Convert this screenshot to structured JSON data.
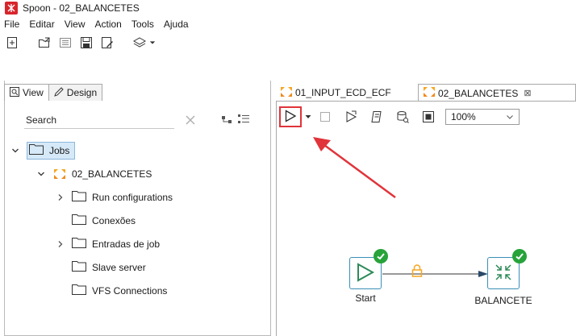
{
  "window": {
    "title": "Spoon - 02_BALANCETES",
    "app_icon": "spoon-app-icon"
  },
  "menu": [
    "File",
    "Editar",
    "View",
    "Action",
    "Tools",
    "Ajuda"
  ],
  "main_toolbar": {
    "icons": [
      "new-file-icon",
      "open-file-icon",
      "explore-repository-icon",
      "save-icon",
      "save-as-icon",
      "perspective-layers-icon",
      "chevron-down-icon"
    ]
  },
  "left_panel": {
    "tabs": [
      {
        "label": "View",
        "icon": "view-icon",
        "active": true
      },
      {
        "label": "Design",
        "icon": "pencil-icon",
        "active": false
      }
    ],
    "search": {
      "placeholder": "Search",
      "value": ""
    },
    "tree": {
      "root": {
        "label": "Jobs",
        "expanded": true,
        "selected": true
      },
      "job": {
        "label": "02_BALANCETES",
        "expanded": true
      },
      "children": [
        {
          "label": "Run configurations",
          "expandable": true
        },
        {
          "label": "Conexões",
          "expandable": false
        },
        {
          "label": "Entradas de job",
          "expandable": true
        },
        {
          "label": "Slave server",
          "expandable": false
        },
        {
          "label": "VFS Connections",
          "expandable": false
        }
      ]
    }
  },
  "editor": {
    "tabs": [
      {
        "label": "01_INPUT_ECD_ECF",
        "active": false
      },
      {
        "label": "02_BALANCETES",
        "active": true,
        "close_symbol": "⊠"
      }
    ],
    "toolbar": {
      "zoom": "100%",
      "icons": [
        "run-icon",
        "run-options-dropdown-icon",
        "stop-icon",
        "replay-icon",
        "sql-icon",
        "check-icon",
        "explore-db-icon"
      ]
    },
    "canvas": {
      "nodes": [
        {
          "label": "Start",
          "status": "success"
        },
        {
          "label": "BALANCETE",
          "status": "success"
        }
      ],
      "hop": {
        "icon": "lock-icon",
        "color": "#f5a623"
      }
    },
    "annotation": {
      "color": "#e0343a",
      "highlight": "run-icon"
    }
  },
  "colors": {
    "accent_red": "#e0343a",
    "node_border": "#3a8fb7",
    "success_green": "#26a33a",
    "selection_bg": "#d6e9f8"
  }
}
